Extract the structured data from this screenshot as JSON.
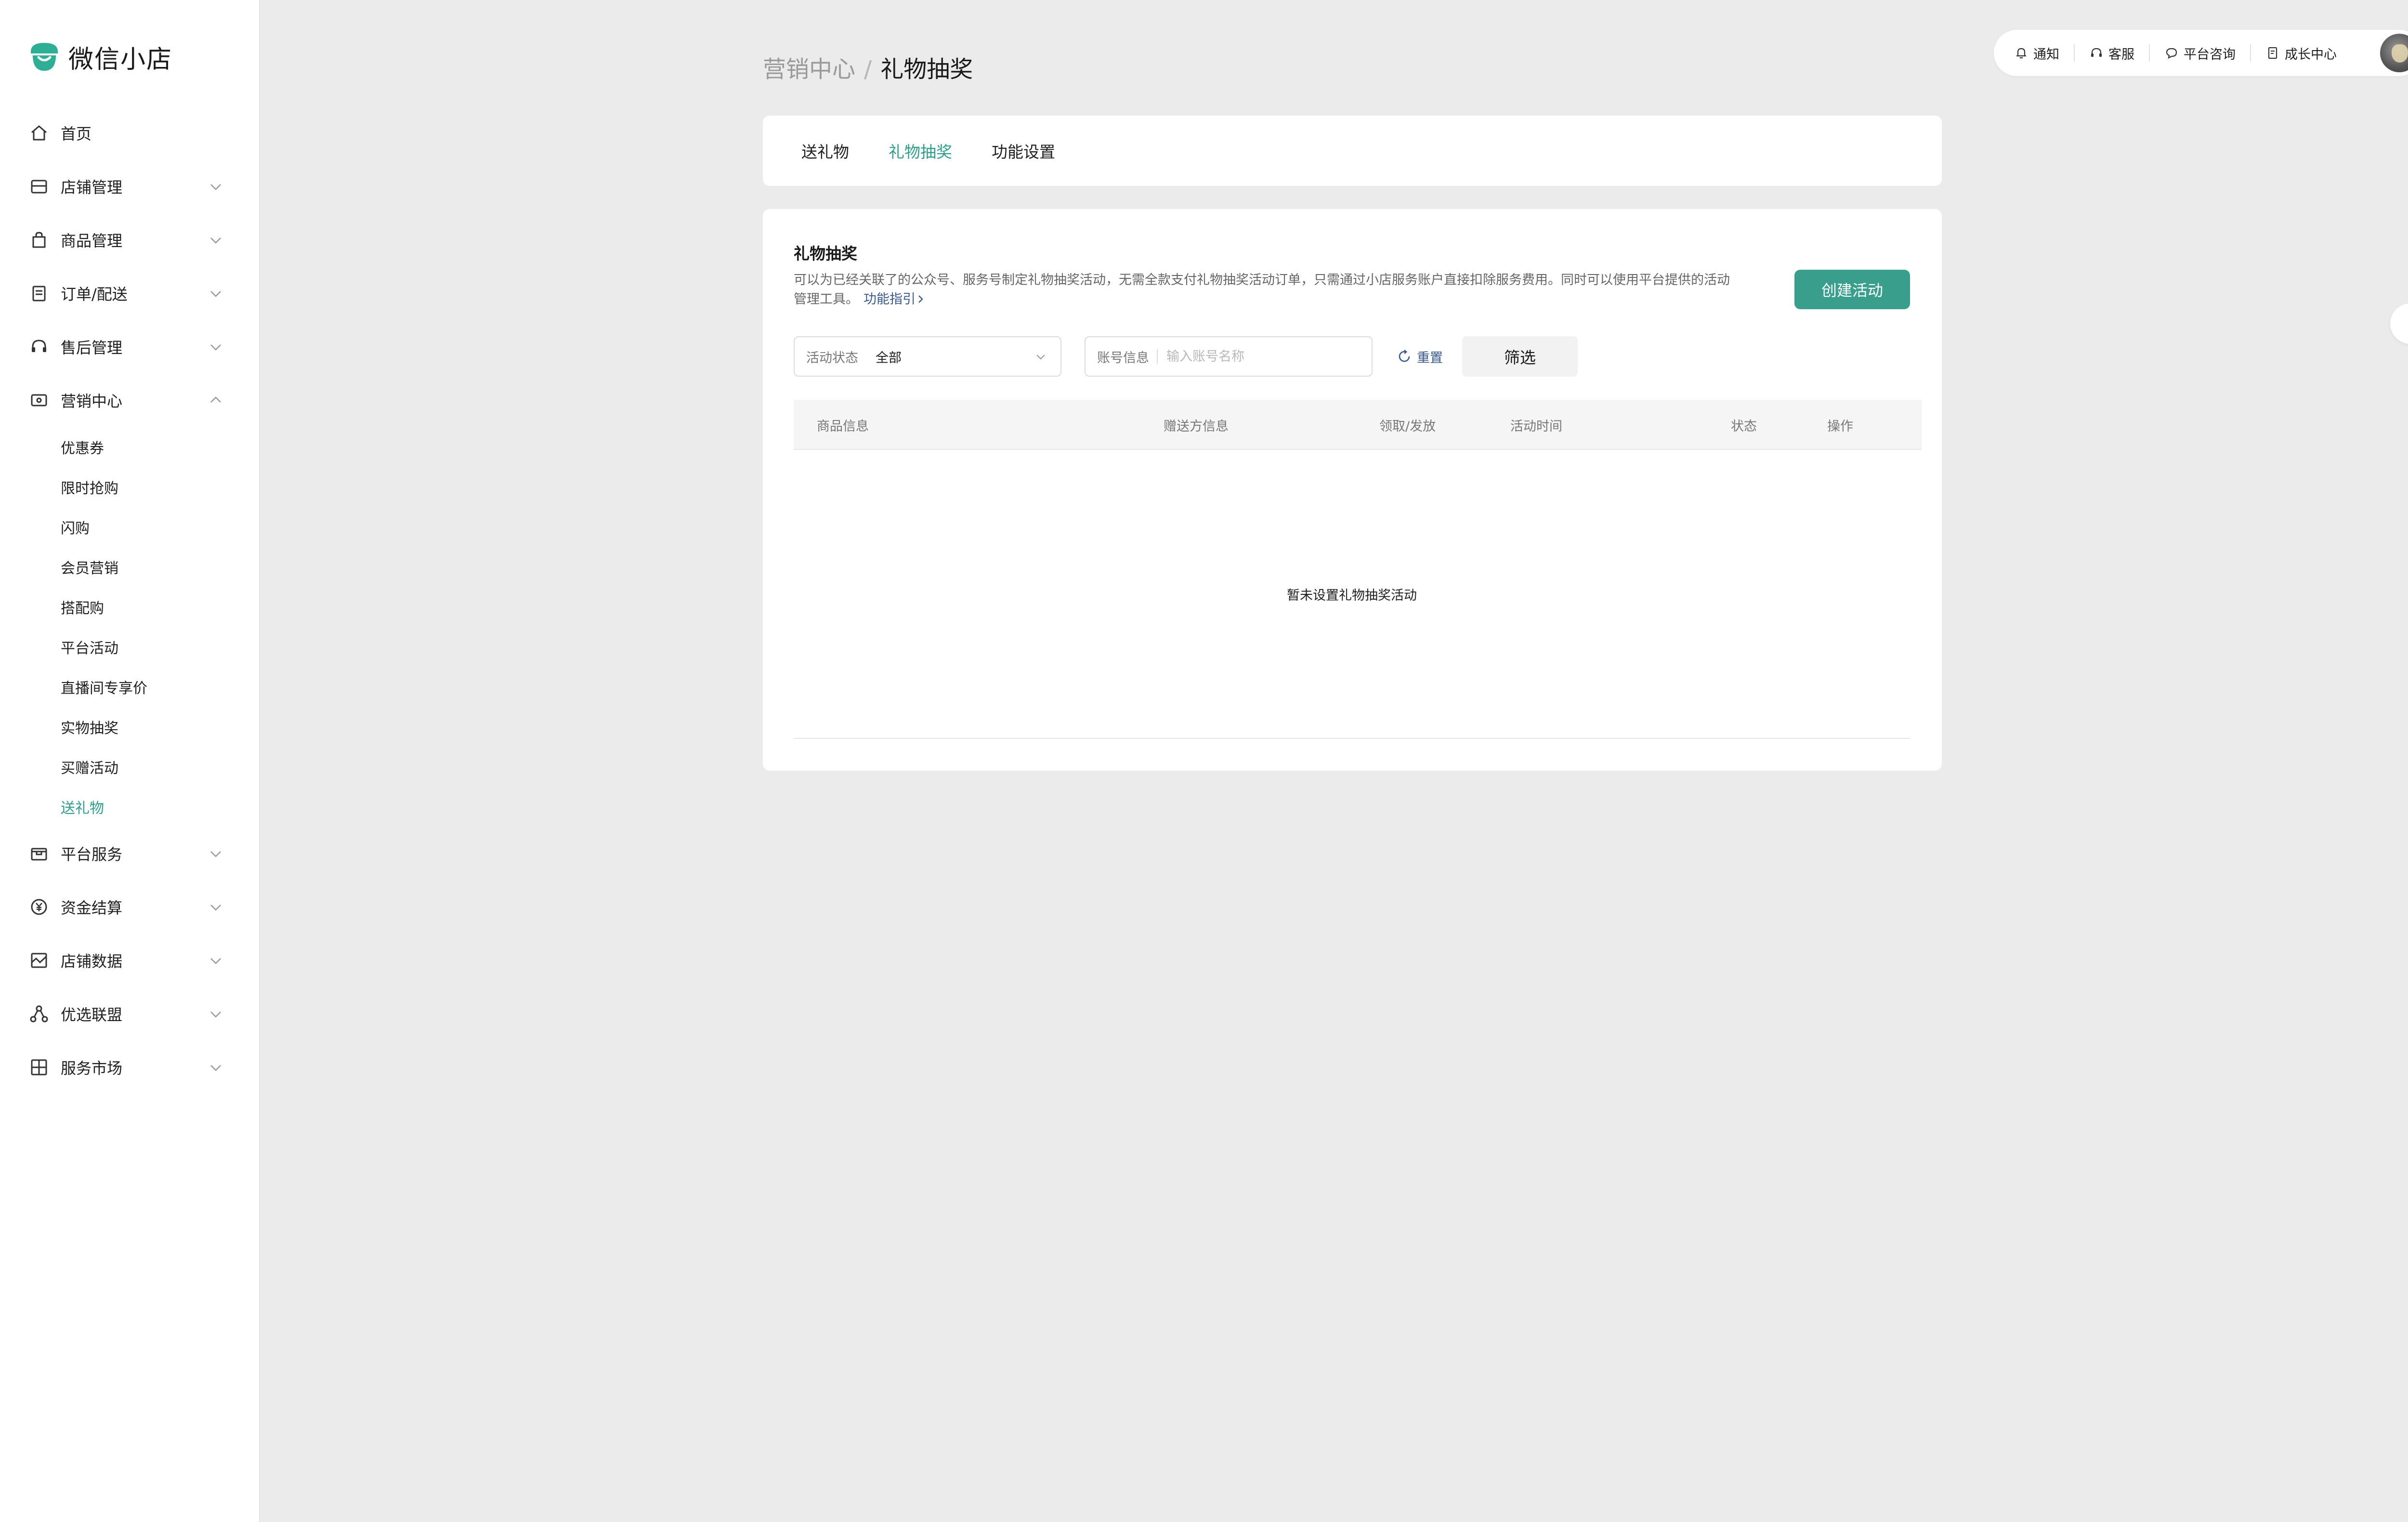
{
  "app": {
    "title": "微信小店"
  },
  "colors": {
    "accent": "#2f9e8c",
    "button": "#3a9e8c",
    "link": "#3b5a8c"
  },
  "sidebar": {
    "items": [
      {
        "label": "首页",
        "icon": "home-icon"
      },
      {
        "label": "店铺管理",
        "icon": "store-icon"
      },
      {
        "label": "商品管理",
        "icon": "bag-icon"
      },
      {
        "label": "订单/配送",
        "icon": "order-icon"
      },
      {
        "label": "售后管理",
        "icon": "headset-icon"
      },
      {
        "label": "营销中心",
        "icon": "ticket-icon"
      },
      {
        "label": "平台服务",
        "icon": "box-icon"
      },
      {
        "label": "资金结算",
        "icon": "yuan-icon"
      },
      {
        "label": "店铺数据",
        "icon": "chart-icon"
      },
      {
        "label": "优选联盟",
        "icon": "network-icon"
      },
      {
        "label": "服务市场",
        "icon": "market-icon"
      }
    ],
    "marketing_sub": [
      "优惠券",
      "限时抢购",
      "闪购",
      "会员营销",
      "搭配购",
      "平台活动",
      "直播间专享价",
      "实物抽奖",
      "买赠活动",
      "送礼物"
    ]
  },
  "topbar": {
    "notice": "通知",
    "service": "客服",
    "consult": "平台咨询",
    "growth": "成长中心"
  },
  "breadcrumb": {
    "parent": "营销中心",
    "separator": "/",
    "current": "礼物抽奖"
  },
  "tabs": [
    "送礼物",
    "礼物抽奖",
    "功能设置"
  ],
  "card": {
    "title": "礼物抽奖",
    "desc_line1": "可以为已经关联了的公众号、服务号制定礼物抽奖活动，无需全款支付礼物抽奖活动订单，只需通过小店服务账户直接扣除服务费用。同时可以使用平台提供的活动",
    "desc_line2": "管理工具。",
    "guide_link": "功能指引",
    "create_button": "创建活动"
  },
  "filters": {
    "status_label": "活动状态",
    "status_value": "全部",
    "account_label": "账号信息",
    "account_placeholder": "输入账号名称",
    "reset": "重置",
    "filter": "筛选"
  },
  "table": {
    "headers": [
      "商品信息",
      "赠送方信息",
      "领取/发放",
      "活动时间",
      "状态",
      "操作"
    ],
    "empty": "暂未设置礼物抽奖活动"
  }
}
